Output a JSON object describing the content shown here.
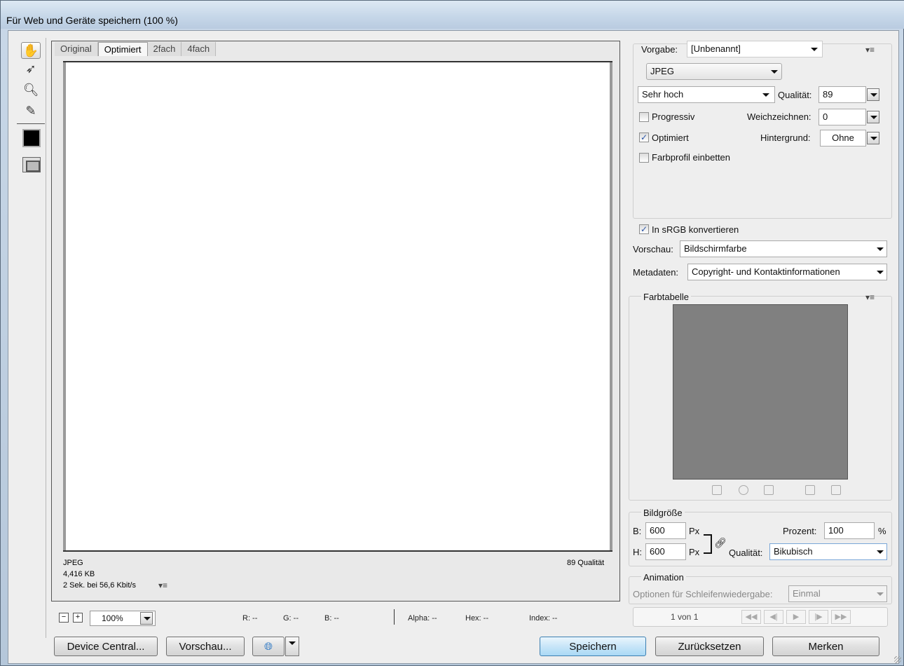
{
  "window": {
    "title": "Für Web und Geräte speichern (100 %)"
  },
  "toolbox": {
    "tools": [
      "hand-tool",
      "slice-select-tool",
      "zoom-tool",
      "eyedropper-tool"
    ],
    "eyedropper_color": "#000000"
  },
  "preview": {
    "tabs": [
      "Original",
      "Optimiert",
      "2fach",
      "4fach"
    ],
    "active_tab": "Optimiert",
    "info": {
      "format": "JPEG",
      "size": "4,416 KB",
      "download_time": "2 Sek. bei 56,6 Kbit/s",
      "quality_label": "89 Qualität"
    }
  },
  "statusbar": {
    "zoom_out": "−",
    "zoom_in": "+",
    "zoom": "100%",
    "r": "R: --",
    "g": "G: --",
    "b": "B: --",
    "alpha": "Alpha: --",
    "hex": "Hex: --",
    "index": "Index: --"
  },
  "buttons": {
    "device_central": "Device Central...",
    "preview": "Vorschau...",
    "save": "Speichern",
    "reset": "Zurücksetzen",
    "remember": "Merken"
  },
  "settings": {
    "preset_label": "Vorgabe:",
    "preset_value": "[Unbenannt]",
    "format": "JPEG",
    "quality_preset": "Sehr hoch",
    "quality_label": "Qualität:",
    "quality_value": "89",
    "progressive_label": "Progressiv",
    "progressive_checked": false,
    "blur_label": "Weichzeichnen:",
    "blur_value": "0",
    "optimized_label": "Optimiert",
    "optimized_checked": true,
    "matte_label": "Hintergrund:",
    "matte_value": "Ohne",
    "embed_profile_label": "Farbprofil einbetten",
    "embed_profile_checked": false,
    "convert_srgb_label": "In sRGB konvertieren",
    "convert_srgb_checked": true,
    "preview_label": "Vorschau:",
    "preview_value": "Bildschirmfarbe",
    "metadata_label": "Metadaten:",
    "metadata_value": "Copyright- und Kontaktinformationen"
  },
  "color_table": {
    "title": "Farbtabelle",
    "swatch_color": "#808080"
  },
  "image_size": {
    "title": "Bildgröße",
    "w_label": "B:",
    "w_value": "600",
    "h_label": "H:",
    "h_value": "600",
    "unit": "Px",
    "percent_label": "Prozent:",
    "percent_value": "100",
    "percent_sign": "%",
    "quality_label": "Qualität:",
    "quality_value": "Bikubisch"
  },
  "animation": {
    "title": "Animation",
    "loop_label": "Optionen für Schleifenwiedergabe:",
    "loop_value": "Einmal",
    "frame": "1 von 1"
  }
}
